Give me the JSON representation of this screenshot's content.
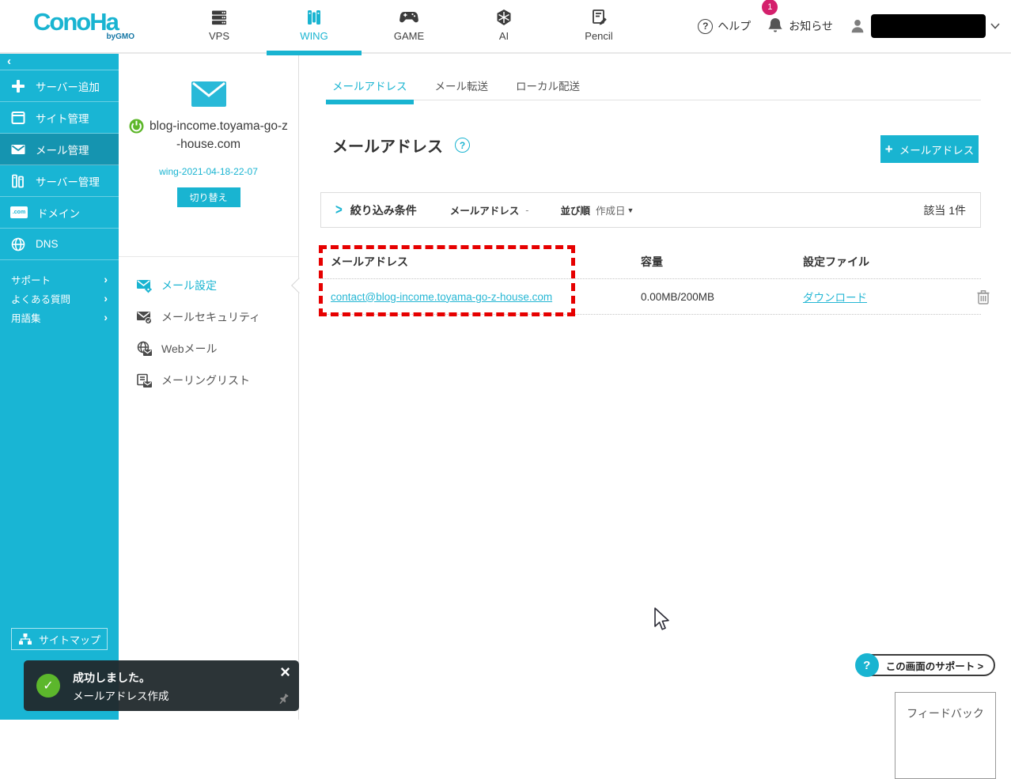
{
  "header": {
    "logo": {
      "brand": "ConoHa",
      "sub": "byGMO"
    },
    "nav": [
      {
        "label": "VPS",
        "active": false
      },
      {
        "label": "WING",
        "active": true
      },
      {
        "label": "GAME",
        "active": false
      },
      {
        "label": "AI",
        "active": false
      },
      {
        "label": "Pencil",
        "active": false
      }
    ],
    "help_label": "ヘルプ",
    "notice_label": "お知らせ",
    "notice_badge": "1"
  },
  "sidebar": {
    "items": [
      {
        "label": "サーバー追加"
      },
      {
        "label": "サイト管理"
      },
      {
        "label": "メール管理",
        "active": true
      },
      {
        "label": "サーバー管理"
      },
      {
        "label": "ドメイン"
      },
      {
        "label": "DNS"
      }
    ],
    "links": [
      {
        "label": "サポート"
      },
      {
        "label": "よくある質問"
      },
      {
        "label": "用語集"
      }
    ],
    "sitemap_label": "サイトマップ"
  },
  "server_panel": {
    "domain_line1": "blog-income.toyama-go-z",
    "domain_line2": "-house.com",
    "server_name": "wing-2021-04-18-22-07",
    "switch_label": "切り替え",
    "menu": [
      {
        "label": "メール設定",
        "active": true
      },
      {
        "label": "メールセキュリティ",
        "active": false
      },
      {
        "label": "Webメール",
        "active": false
      },
      {
        "label": "メーリングリスト",
        "active": false
      }
    ]
  },
  "main": {
    "tabs": [
      {
        "label": "メールアドレス",
        "active": true
      },
      {
        "label": "メール転送",
        "active": false
      },
      {
        "label": "ローカル配送",
        "active": false
      }
    ],
    "title": "メールアドレス",
    "add_button_label": "メールアドレス",
    "filter": {
      "label": "絞り込み条件",
      "field_label": "メールアドレス",
      "field_value": "-",
      "sort_label": "並び順",
      "sort_value": "作成日",
      "count": "該当 1件"
    },
    "table": {
      "headers": [
        "メールアドレス",
        "容量",
        "設定ファイル"
      ],
      "rows": [
        {
          "email": "contact@blog-income.toyama-go-z-house.com",
          "quota": "0.00MB/200MB",
          "config_link": "ダウンロード"
        }
      ]
    }
  },
  "toast": {
    "title": "成功しました。",
    "message": "メールアドレス作成"
  },
  "support_button_label": "この画面のサポート >",
  "feedback_button_label": "フィードバック",
  "glyphs": {
    "collapse": "‹",
    "chevron_right": "›",
    "filter_chevron": ">",
    "sort_caret": "▼",
    "question": "?",
    "plus": "+",
    "close": "×",
    "check": "✓",
    "domain_icon_text": ".com"
  },
  "colors": {
    "accent": "#19b4d1",
    "sidebar": "#19b5d4",
    "sidebar_active": "#1594b0",
    "badge": "#d4206c",
    "success_green": "#5cb72c",
    "highlight_red": "#e60000"
  }
}
